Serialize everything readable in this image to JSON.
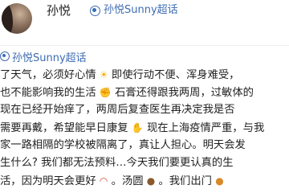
{
  "author": {
    "name": "孙悦",
    "topic": "孙悦Sunny超话"
  },
  "repost": {
    "topic": "孙悦Sunny超话"
  },
  "post": {
    "lines": [
      "了天气，必须好心情",
      "即使行动不便、浑身难受，",
      "也不能影响我的生活",
      "石膏还得跟我两周，过敏体的",
      "现在已经开始痒了，两周后复查医生再决定我是否",
      "需要再戴，希望能早日康复",
      "现在上海疫情严重，与我",
      "家一路相隔的学校被隔离了，真让人担心。明天会发",
      "生什么? 我们都无法预料…今天我们要更认真的生",
      "活，因为明天会更好",
      "。汤圆",
      "。我们出门"
    ],
    "emojis": {
      "sun": "☀",
      "arm": "✊",
      "pray": "✋",
      "rainbow": "◠",
      "dog": "●",
      "cat": "●"
    }
  },
  "colors": {
    "link": "#3d6cb3",
    "text": "#1f1f1f",
    "background": "#ffffff"
  }
}
